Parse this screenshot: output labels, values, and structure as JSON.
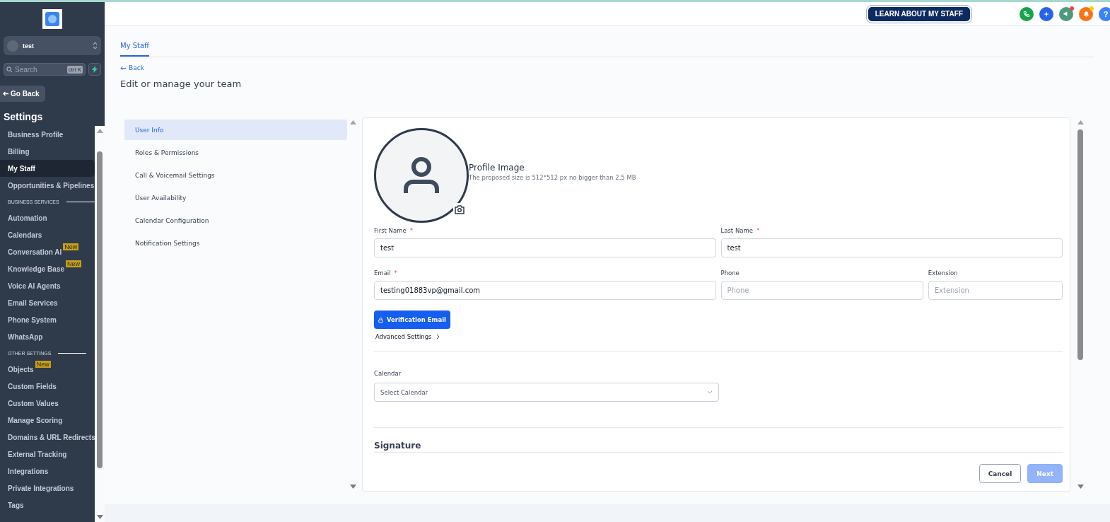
{
  "account": {
    "name": "test"
  },
  "search": {
    "placeholder": "Search",
    "shortcut": "ctrl K"
  },
  "go_back": "Go Back",
  "sidebar": {
    "title": "Settings",
    "items": [
      {
        "kind": "item",
        "label": "Business Profile",
        "selected": false
      },
      {
        "kind": "item",
        "label": "Billing",
        "selected": false
      },
      {
        "kind": "item",
        "label": "My Staff",
        "selected": true
      },
      {
        "kind": "item",
        "label": "Opportunities & Pipelines",
        "selected": false
      },
      {
        "kind": "heading",
        "label": "BUSINESS SERVICES"
      },
      {
        "kind": "item",
        "label": "Automation",
        "selected": false
      },
      {
        "kind": "item",
        "label": "Calendars",
        "selected": false
      },
      {
        "kind": "item",
        "label": "Conversation AI",
        "selected": false,
        "badge": "New"
      },
      {
        "kind": "item",
        "label": "Knowledge Base",
        "selected": false,
        "badge": "New"
      },
      {
        "kind": "item",
        "label": "Voice AI Agents",
        "selected": false
      },
      {
        "kind": "item",
        "label": "Email Services",
        "selected": false
      },
      {
        "kind": "item",
        "label": "Phone System",
        "selected": false
      },
      {
        "kind": "item",
        "label": "WhatsApp",
        "selected": false
      },
      {
        "kind": "heading",
        "label": "OTHER SETTINGS"
      },
      {
        "kind": "item",
        "label": "Objects",
        "selected": false,
        "badge": "New"
      },
      {
        "kind": "item",
        "label": "Custom Fields",
        "selected": false
      },
      {
        "kind": "item",
        "label": "Custom Values",
        "selected": false
      },
      {
        "kind": "item",
        "label": "Manage Scoring",
        "selected": false
      },
      {
        "kind": "item",
        "label": "Domains & URL Redirects",
        "selected": false
      },
      {
        "kind": "item",
        "label": "External Tracking",
        "selected": false
      },
      {
        "kind": "item",
        "label": "Integrations",
        "selected": false
      },
      {
        "kind": "item",
        "label": "Private Integrations",
        "selected": false
      },
      {
        "kind": "item",
        "label": "Tags",
        "selected": false
      }
    ]
  },
  "topbar": {
    "learn_button": "LEARN ABOUT MY STAFF",
    "actions": [
      {
        "kind": "phone",
        "color": "#16a34a"
      },
      {
        "kind": "sparkle",
        "color": "#2563eb"
      },
      {
        "kind": "megaphone",
        "color": "#4b9a7a",
        "badge": {
          "color": "#ef4444"
        }
      },
      {
        "kind": "bell",
        "color": "#f97316",
        "badge": {
          "color": "#facc15"
        }
      },
      {
        "kind": "help",
        "color": "#3b82f6",
        "text": "?"
      }
    ]
  },
  "tabs": [
    {
      "label": "My Staff",
      "selected": true
    }
  ],
  "back": "Back",
  "page_title": "Edit or manage your team",
  "nav": [
    {
      "label": "User Info",
      "selected": true
    },
    {
      "label": "Roles & Permissions",
      "selected": false
    },
    {
      "label": "Call & Voicemail Settings",
      "selected": false
    },
    {
      "label": "User Availability",
      "selected": false
    },
    {
      "label": "Calendar Configuration",
      "selected": false
    },
    {
      "label": "Notification Settings",
      "selected": false
    }
  ],
  "profile": {
    "title": "Profile Image",
    "hint": "The proposed size is 512*512 px no bigger than 2.5 MB"
  },
  "field_rows": [
    [
      {
        "label": "First Name",
        "required": true,
        "value": "test"
      },
      {
        "label": "Last Name",
        "required": true,
        "value": "test"
      }
    ],
    [
      {
        "label": "Email",
        "required": true,
        "value": "testing01883vp@gmail.com"
      },
      {
        "label": "Phone",
        "required": false,
        "placeholder": "Phone"
      },
      {
        "label": "Extension",
        "required": false,
        "placeholder": "Extension"
      }
    ]
  ],
  "required_mark": "*",
  "verify_button": "Verification Email",
  "advanced": "Advanced Settings",
  "calendar": {
    "label": "Calendar",
    "placeholder": "Select Calendar"
  },
  "signature": "Signature",
  "buttons": [
    {
      "label": "Cancel",
      "kind": "secondary",
      "disabled": false
    },
    {
      "label": "Next",
      "kind": "primary",
      "disabled": true
    }
  ]
}
